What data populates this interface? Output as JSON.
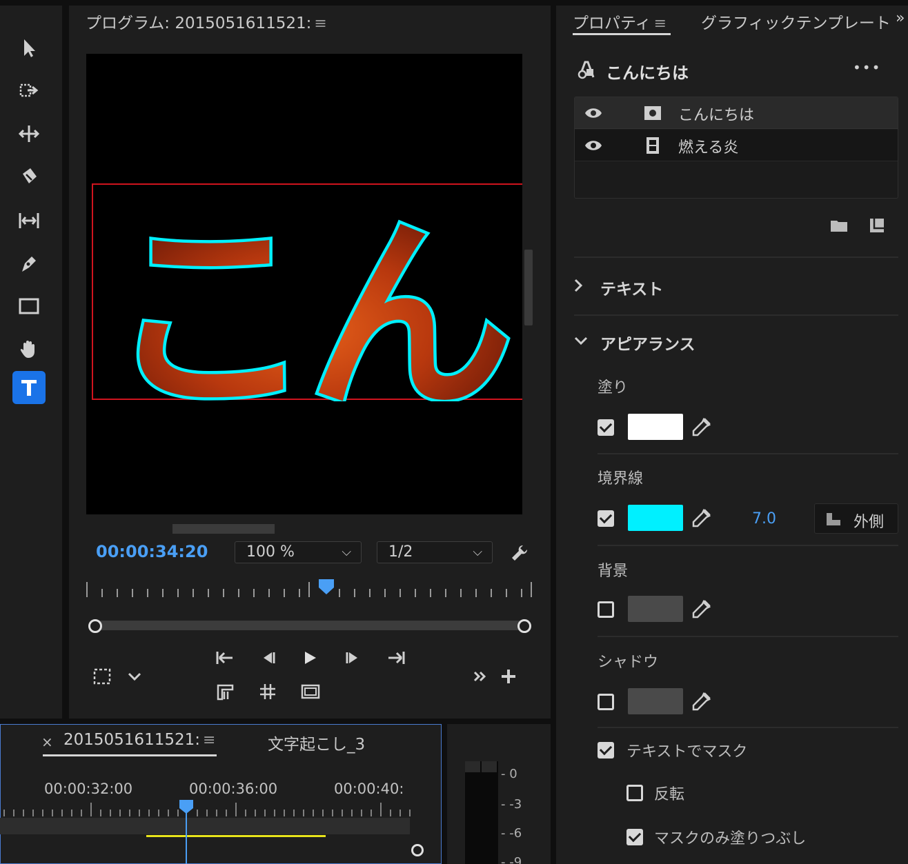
{
  "colors": {
    "accent_blue": "#4a9ff5",
    "selection_red": "#d0141e",
    "stroke_cyan": "#00f0ff",
    "fill_white": "#ffffff",
    "background_swatch": "#4a4a4a"
  },
  "tools": [
    {
      "name": "selection-tool",
      "icon": "arrow-icon"
    },
    {
      "name": "track-select-tool",
      "icon": "track-select-icon"
    },
    {
      "name": "ripple-edit-tool",
      "icon": "ripple-icon"
    },
    {
      "name": "razor-tool",
      "icon": "razor-icon"
    },
    {
      "name": "slip-tool",
      "icon": "slip-icon"
    },
    {
      "name": "pen-tool",
      "icon": "pen-icon"
    },
    {
      "name": "rectangle-tool",
      "icon": "rectangle-icon"
    },
    {
      "name": "hand-tool",
      "icon": "hand-icon"
    },
    {
      "name": "type-tool",
      "icon": "type-icon",
      "active": true
    }
  ],
  "program": {
    "title": "プログラム: 2015051611521:",
    "preview_text": "こん",
    "timecode": "00:00:34:20",
    "zoom": "100 %",
    "resolution": "1/2"
  },
  "properties": {
    "tab_properties": "プロパティ",
    "tab_graphics": "グラフィックテンプレート",
    "object_name": "こんにちは",
    "more": "•••",
    "layers": [
      {
        "name": "こんにちは",
        "type": "text-layer-icon"
      },
      {
        "name": "燃える炎",
        "type": "video-layer-icon"
      }
    ],
    "section_text": "テキスト",
    "section_appearance": "アピアランス",
    "fill_label": "塗り",
    "stroke_label": "境界線",
    "stroke_width": "7.0",
    "stroke_position": "外側",
    "background_label": "背景",
    "shadow_label": "シャドウ",
    "mask_label": "テキストでマスク",
    "invert_label": "反転",
    "mask_fill_label": "マスクのみ塗りつぶし"
  },
  "timeline": {
    "sequence_tab": "2015051611521:",
    "other_tab": "文字起こし_3",
    "close": "×",
    "times": [
      "00:00:32:00",
      "00:00:36:00",
      "00:00:40:"
    ]
  },
  "meter": {
    "labels": [
      "0",
      "-3",
      "-6",
      "-9"
    ]
  }
}
